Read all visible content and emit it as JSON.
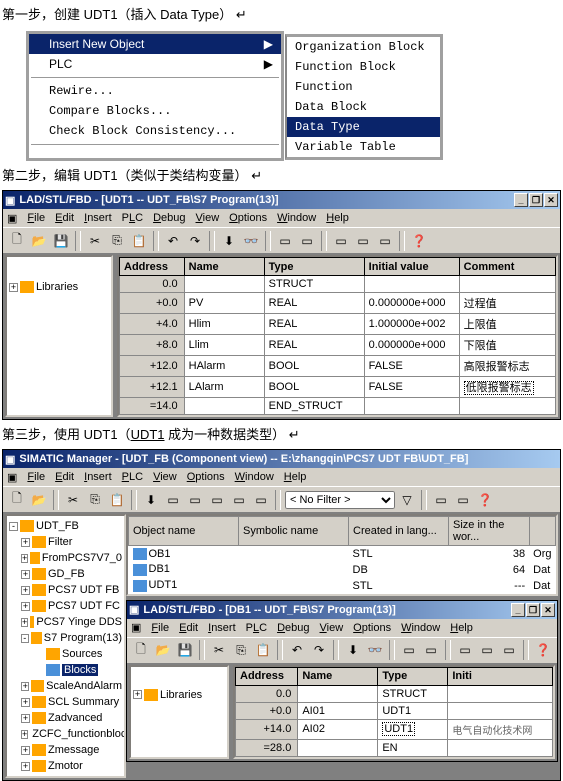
{
  "step1": {
    "title": "第一步，创建 UDT1（插入 Data Type）",
    "menu": {
      "insert_new": "Insert New Object",
      "plc": "PLC",
      "rewire": "Rewire...",
      "compare": "Compare Blocks...",
      "check": "Check Block Consistency..."
    },
    "submenu": {
      "org_block": "Organization Block",
      "func_block": "Function Block",
      "function": "Function",
      "data_block": "Data Block",
      "data_type": "Data Type",
      "var_table": "Variable Table"
    }
  },
  "step2": {
    "title_pre": "第二步，编辑 UDT1（类似于类结构变量）",
    "win_title": "LAD/STL/FBD  - [UDT1 -- UDT_FB\\S7 Program(13)]",
    "menu": {
      "file": "File",
      "edit": "Edit",
      "insert": "Insert",
      "plc": "PLC",
      "debug": "Debug",
      "view": "View",
      "options": "Options",
      "window": "Window",
      "help": "Help"
    },
    "tree_root": "Libraries",
    "grid": {
      "headers": {
        "address": "Address",
        "name": "Name",
        "type": "Type",
        "init": "Initial value",
        "comment": "Comment"
      },
      "rows": [
        {
          "addr": "0.0",
          "name": "",
          "type": "STRUCT",
          "init": "",
          "comment": ""
        },
        {
          "addr": "+0.0",
          "name": "PV",
          "type": "REAL",
          "init": "0.000000e+000",
          "comment": "过程值"
        },
        {
          "addr": "+4.0",
          "name": "Hlim",
          "type": "REAL",
          "init": "1.000000e+002",
          "comment": "上限值"
        },
        {
          "addr": "+8.0",
          "name": "Llim",
          "type": "REAL",
          "init": "0.000000e+000",
          "comment": "下限值"
        },
        {
          "addr": "+12.0",
          "name": "HAlarm",
          "type": "BOOL",
          "init": "FALSE",
          "comment": "高限报警标志"
        },
        {
          "addr": "+12.1",
          "name": "LAlarm",
          "type": "BOOL",
          "init": "FALSE",
          "comment": "低限报警标志"
        },
        {
          "addr": "=14.0",
          "name": "",
          "type": "END_STRUCT",
          "init": "",
          "comment": ""
        }
      ]
    }
  },
  "step3": {
    "title_pre": "第三步，使用 UDT1（",
    "title_udt": "UDT1",
    "title_post": " 成为一种数据类型）",
    "mgr_title": "SIMATIC Manager - [UDT_FB (Component view) -- E:\\zhangqin\\PCS7 UDT FB\\UDT_FB]",
    "mgr_menu": {
      "file": "File",
      "edit": "Edit",
      "insert": "Insert",
      "plc": "PLC",
      "view": "View",
      "options": "Options",
      "window": "Window",
      "help": "Help"
    },
    "filter_label": "< No Filter >",
    "tree": [
      "UDT_FB",
      "Filter",
      "FromPCS7V7_0",
      "GD_FB",
      "PCS7 UDT FB",
      "PCS7 UDT FC",
      "PCS7 Yinge DDS",
      "S7 Program(13)",
      "Sources",
      "Blocks",
      "ScaleAndAlarm",
      "SCL Summary",
      "Zadvanced",
      "ZCFC_functionblock",
      "Zmessage",
      "Zmotor"
    ],
    "obj_headers": {
      "name": "Object name",
      "sym": "Symbolic name",
      "created": "Created in lang...",
      "size": "Size in the wor..."
    },
    "obj_rows": [
      {
        "name": "OB1",
        "sym": "",
        "created": "STL",
        "size": "38",
        "ext": "Org"
      },
      {
        "name": "DB1",
        "sym": "",
        "created": "DB",
        "size": "64",
        "ext": "Dat"
      },
      {
        "name": "UDT1",
        "sym": "",
        "created": "STL",
        "size": "---",
        "ext": "Dat"
      }
    ],
    "inner_title": "LAD/STL/FBD  - [DB1 -- UDT_FB\\S7 Program(13)]",
    "inner_tree": "Libraries",
    "inner_grid": {
      "headers": {
        "address": "Address",
        "name": "Name",
        "type": "Type",
        "init": "Initi"
      },
      "rows": [
        {
          "addr": "0.0",
          "name": "",
          "type": "STRUCT",
          "init": "",
          "extra": ""
        },
        {
          "addr": "+0.0",
          "name": "AI01",
          "type": "UDT1",
          "init": "",
          "extra": ""
        },
        {
          "addr": "+14.0",
          "name": "AI02",
          "type": "UDT1",
          "init": "",
          "extra": "电气自动化技术网"
        },
        {
          "addr": "=28.0",
          "name": "",
          "type": "EN",
          "init": "",
          "extra": ""
        }
      ]
    }
  }
}
